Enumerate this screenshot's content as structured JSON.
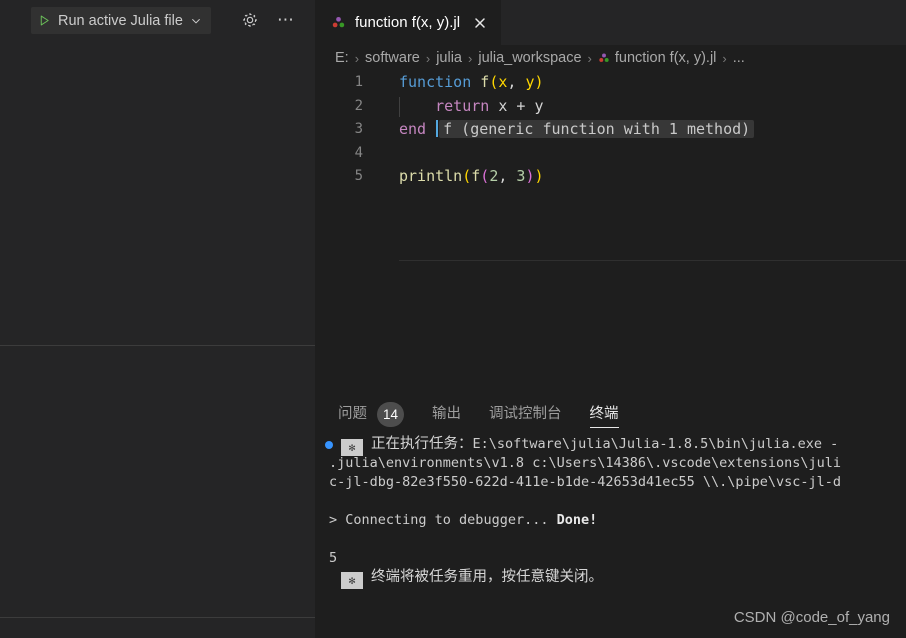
{
  "sidebar": {
    "run_button": {
      "label": "Run active Julia file",
      "play_icon": "play-triangle-icon",
      "chevron_icon": "chevron-down-icon"
    },
    "gear_icon": "gear-icon",
    "more_icon": "ellipsis-icon",
    "more_label": "⋯"
  },
  "tab": {
    "title": "function f(x, y).jl",
    "file_icon": "julia-file-icon",
    "close_icon": "close-icon"
  },
  "breadcrumb": {
    "items": [
      {
        "label": "E:"
      },
      {
        "label": "software"
      },
      {
        "label": "julia"
      },
      {
        "label": "julia_workspace"
      },
      {
        "label": "function f(x, y).jl",
        "icon": "julia-file-icon"
      },
      {
        "label": "..."
      }
    ],
    "separator": "›"
  },
  "editor": {
    "lines": [
      {
        "number": "1",
        "tokens": [
          {
            "text": "function",
            "cls": "t-kw"
          },
          {
            "text": " ",
            "cls": "t-plain"
          },
          {
            "text": "f",
            "cls": "t-fn"
          },
          {
            "text": "(",
            "cls": "t-par1"
          },
          {
            "text": "x",
            "cls": "t-par1"
          },
          {
            "text": ", ",
            "cls": "t-plain"
          },
          {
            "text": "y",
            "cls": "t-par1"
          },
          {
            "text": ")",
            "cls": "t-par1"
          }
        ]
      },
      {
        "number": "2",
        "indent_guide": true,
        "tokens": [
          {
            "text": "    ",
            "cls": "t-plain"
          },
          {
            "text": "return",
            "cls": "t-kw2"
          },
          {
            "text": " x ",
            "cls": "t-plain"
          },
          {
            "text": "+",
            "cls": "t-op"
          },
          {
            "text": " y",
            "cls": "t-plain"
          }
        ]
      },
      {
        "number": "3",
        "tokens": [
          {
            "text": "end",
            "cls": "t-kw2"
          },
          {
            "text": " ",
            "cls": "t-plain"
          }
        ],
        "cursor": true,
        "inlay": "f (generic function with 1 method)"
      },
      {
        "number": "4",
        "tokens": []
      },
      {
        "number": "5",
        "tokens": [
          {
            "text": "println",
            "cls": "t-fn"
          },
          {
            "text": "(",
            "cls": "t-par1"
          },
          {
            "text": "f",
            "cls": "t-fn"
          },
          {
            "text": "(",
            "cls": "t-par2"
          },
          {
            "text": "2",
            "cls": "t-num"
          },
          {
            "text": ", ",
            "cls": "t-plain"
          },
          {
            "text": "3",
            "cls": "t-num"
          },
          {
            "text": ")",
            "cls": "t-par2"
          },
          {
            "text": ")",
            "cls": "t-par1"
          }
        ]
      }
    ]
  },
  "panel": {
    "tabs": [
      {
        "label": "问题",
        "badge": "14",
        "active": false
      },
      {
        "label": "输出",
        "badge": null,
        "active": false
      },
      {
        "label": "调试控制台",
        "badge": null,
        "active": false
      },
      {
        "label": "终端",
        "badge": null,
        "active": true
      }
    ]
  },
  "terminal": {
    "lines": [
      {
        "type": "task-start",
        "dot": true,
        "star": "✻",
        "cn_text": "正在执行任务：",
        "mono_text": "E:\\software\\julia\\Julia-1.8.5\\bin\\julia.exe -"
      },
      {
        "type": "mono",
        "mono_text": ".julia\\environments\\v1.8 c:\\Users\\14386\\.vscode\\extensions\\juli"
      },
      {
        "type": "mono",
        "mono_text": "c-jl-dbg-82e3f550-622d-411e-b1de-42653d41ec55 \\\\.\\pipe\\vsc-jl-d"
      },
      {
        "type": "blank"
      },
      {
        "type": "prompt",
        "prompt": ">",
        "mono_text": " Connecting to debugger... ",
        "bold_text": "Done!"
      },
      {
        "type": "blank"
      },
      {
        "type": "mono",
        "mono_text": "5"
      },
      {
        "type": "task-end",
        "star": "✻",
        "cn_text": "终端将被任务重用，按任意键关闭。"
      }
    ]
  },
  "watermark": {
    "text": "CSDN @code_of_yang"
  },
  "colors": {
    "editor_bg": "#1e1e1e",
    "sidebar_bg": "#252526",
    "accent_blue": "#3794ff",
    "keyword": "#569cd6",
    "control_keyword": "#c586c0",
    "function_name": "#dcdcaa",
    "number": "#b5cea8",
    "paren_level1": "#ffd700",
    "paren_level2": "#da70d6",
    "line_number": "#858585",
    "inlay_bg": "#373737"
  }
}
